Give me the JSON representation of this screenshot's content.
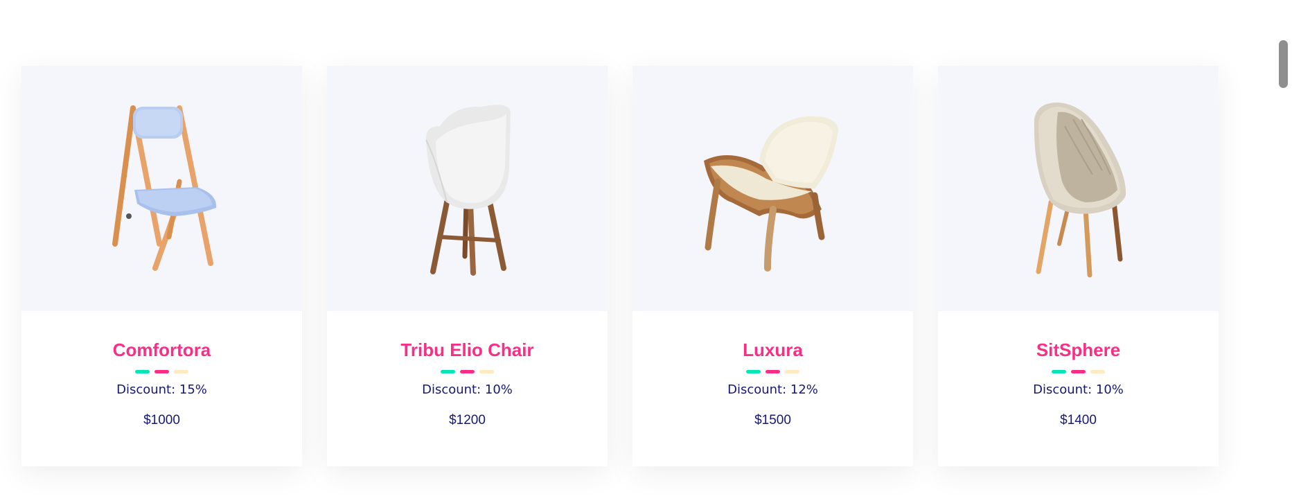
{
  "theme": {
    "title_color": "#fb2e86",
    "text_color": "#151875",
    "image_bg": "#f5f6fb",
    "dash_colors": [
      "#05e6b7",
      "#fb2e86",
      "#ffeac1"
    ]
  },
  "products": [
    {
      "name": "Comfortora",
      "discount": "Discount: 15%",
      "price": "$1000",
      "image_icon": "folding-chair-icon"
    },
    {
      "name": "Tribu Elio Chair",
      "discount": "Discount: 10%",
      "price": "$1200",
      "image_icon": "shell-armchair-icon"
    },
    {
      "name": "Luxura",
      "discount": "Discount: 12%",
      "price": "$1500",
      "image_icon": "lounge-chair-icon"
    },
    {
      "name": "SitSphere",
      "discount": "Discount: 10%",
      "price": "$1400",
      "image_icon": "cocoon-chair-icon"
    }
  ]
}
